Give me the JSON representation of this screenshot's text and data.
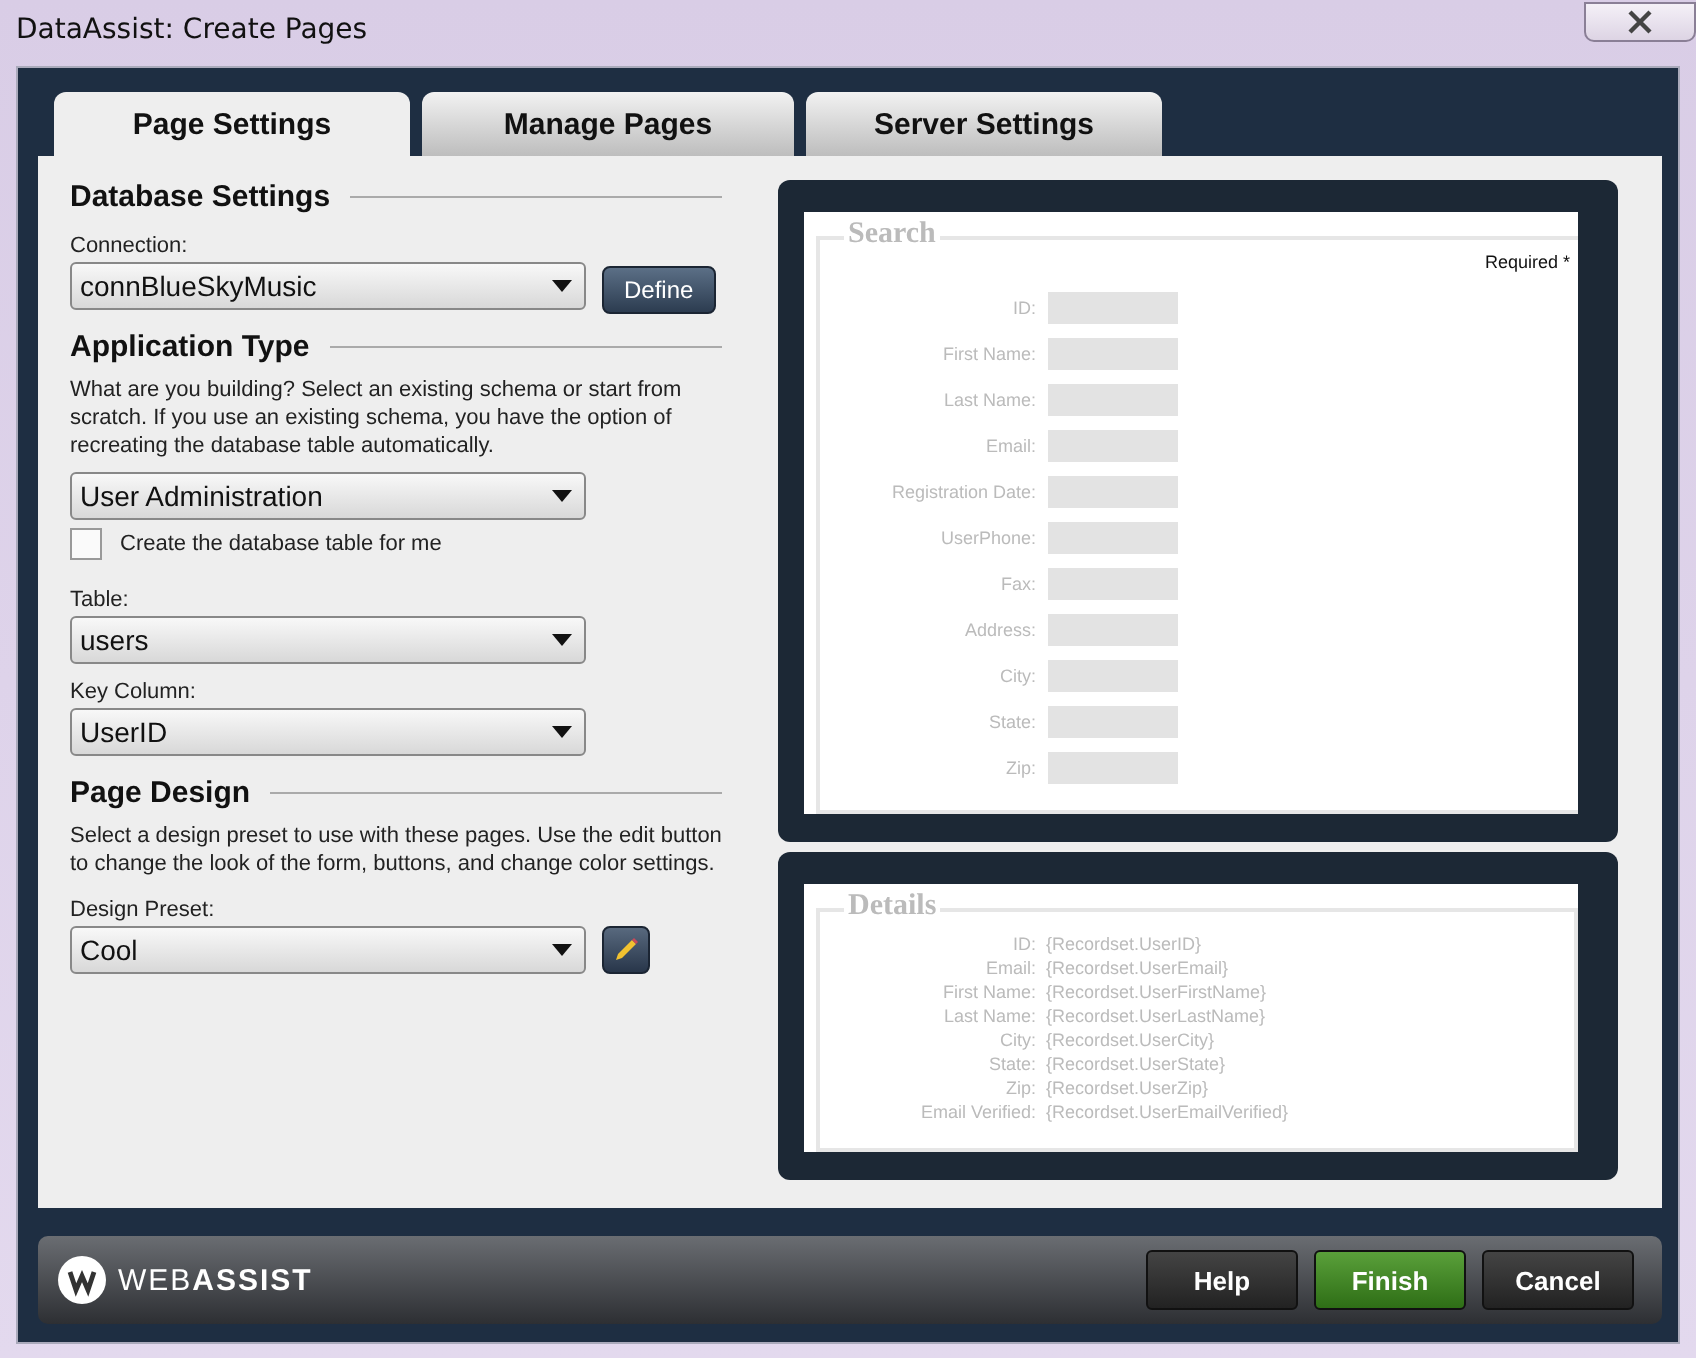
{
  "window": {
    "title": "DataAssist: Create Pages"
  },
  "tabs": [
    {
      "label": "Page Settings",
      "selected": true
    },
    {
      "label": "Manage Pages",
      "selected": false
    },
    {
      "label": "Server Settings",
      "selected": false
    }
  ],
  "database_settings": {
    "heading": "Database Settings",
    "connection_label": "Connection:",
    "connection": "connBlueSkyMusic",
    "define_button": "Define"
  },
  "application_type": {
    "heading": "Application Type",
    "description": "What are you building? Select an existing schema or start from scratch. If you use an existing schema, you have the option of recreating the database table automatically.",
    "value": "User Administration",
    "create_table": {
      "label": "Create the database table for me",
      "checked": false
    },
    "table_label": "Table:",
    "table": "users",
    "key_column_label": "Key Column:",
    "key_column": "UserID"
  },
  "page_design": {
    "heading": "Page Design",
    "description": "Select a design preset to use with these pages. Use the edit button to change the look of the form, buttons, and change color settings.",
    "preset_label": "Design Preset:",
    "preset": "Cool"
  },
  "search_preview": {
    "title": "Search",
    "required_note": "Required *",
    "fields": [
      "ID:",
      "First Name:",
      "Last Name:",
      "Email:",
      "Registration Date:",
      "UserPhone:",
      "Fax:",
      "Address:",
      "City:",
      "State:",
      "Zip:"
    ]
  },
  "details_preview": {
    "title": "Details",
    "rows": [
      {
        "label": "ID:",
        "value": "{Recordset.UserID}"
      },
      {
        "label": "Email:",
        "value": "{Recordset.UserEmail}"
      },
      {
        "label": "First Name:",
        "value": "{Recordset.UserFirstName}"
      },
      {
        "label": "Last Name:",
        "value": "{Recordset.UserLastName}"
      },
      {
        "label": "City:",
        "value": "{Recordset.UserCity}"
      },
      {
        "label": "State:",
        "value": "{Recordset.UserState}"
      },
      {
        "label": "Zip:",
        "value": "{Recordset.UserZip}"
      },
      {
        "label": "Email Verified:",
        "value": "{Recordset.UserEmailVerified}"
      }
    ]
  },
  "footer": {
    "logo": "WEB**ASSIST**",
    "buttons": [
      {
        "label": "Help",
        "kind": "normal"
      },
      {
        "label": "Finish",
        "kind": "primary"
      },
      {
        "label": "Cancel",
        "kind": "normal"
      }
    ]
  }
}
